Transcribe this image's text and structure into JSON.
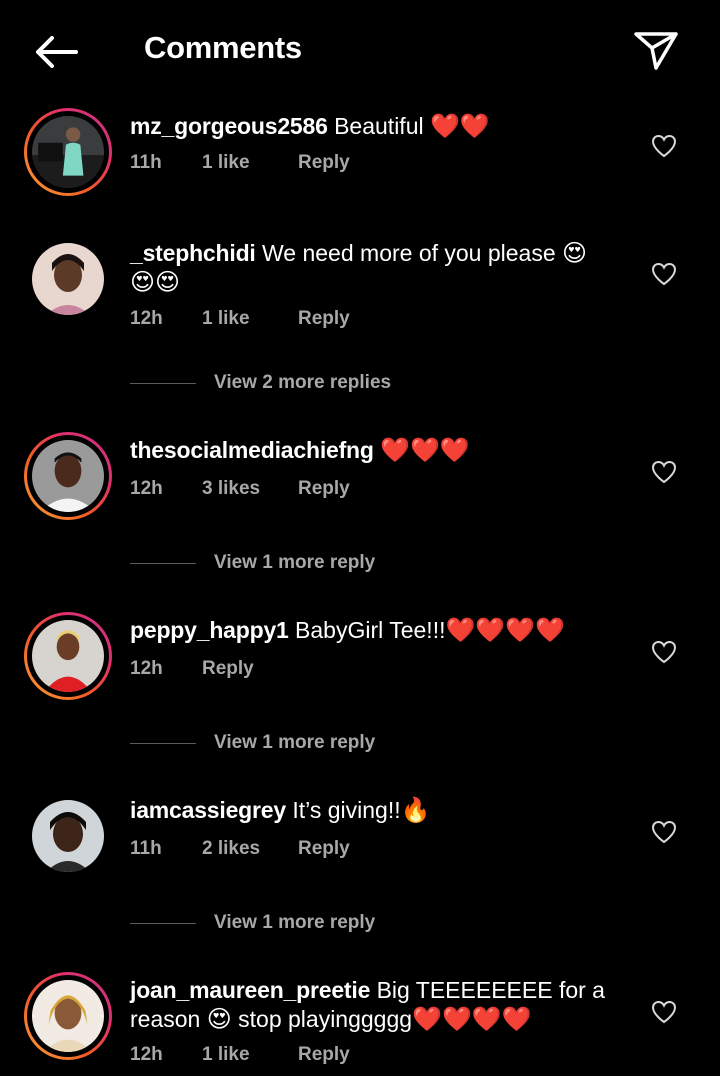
{
  "header": {
    "title": "Comments",
    "back_icon": "arrow-left-icon",
    "send_icon": "paper-plane-icon"
  },
  "comments": [
    {
      "username": "mz_gorgeous2586",
      "text": "Beautiful ",
      "emoji": "❤️❤️",
      "time": "11h",
      "likes": "1 like",
      "reply": "Reply",
      "has_story_ring": true
    },
    {
      "username": "_stephchidi",
      "text": "We need more of you please ",
      "emoji": "😍😍😍",
      "time": "12h",
      "likes": "1 like",
      "reply": "Reply",
      "has_story_ring": false,
      "view_more": "View 2 more replies"
    },
    {
      "username": "thesocialmediachiefng",
      "text": "",
      "emoji": "❤️❤️❤️",
      "time": "12h",
      "likes": "3 likes",
      "reply": "Reply",
      "has_story_ring": true,
      "view_more": "View 1 more reply"
    },
    {
      "username": "peppy_happy1",
      "text": "BabyGirl Tee!!!",
      "emoji": "❤️❤️❤️❤️",
      "time": "12h",
      "likes": "",
      "reply": "Reply",
      "has_story_ring": true,
      "view_more": "View 1 more reply"
    },
    {
      "username": "iamcassiegrey",
      "text": "It’s giving!!",
      "emoji": "🔥",
      "time": "11h",
      "likes": "2 likes",
      "reply": "Reply",
      "has_story_ring": false,
      "view_more": "View 1 more reply"
    },
    {
      "username": "joan_maureen_preetie",
      "text": "Big TEEEEEEEE for a reason ",
      "emoji": "😍",
      "text2": " stop playinggggg",
      "emoji2": "❤️❤️❤️❤️",
      "time": "12h",
      "likes": "1 like",
      "reply": "Reply",
      "has_story_ring": true
    }
  ],
  "colors": {
    "background": "#000000",
    "text": "#ffffff",
    "muted": "#a8a8a8",
    "ring_start": "#f9a23a",
    "ring_end": "#c13584"
  }
}
